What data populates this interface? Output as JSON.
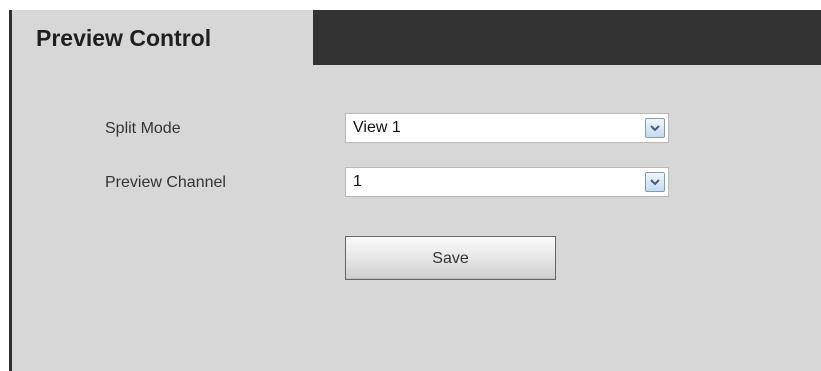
{
  "header": {
    "title": "Preview Control"
  },
  "form": {
    "split_mode": {
      "label": "Split Mode",
      "value": "View 1"
    },
    "preview_channel": {
      "label": "Preview Channel",
      "value": "1"
    },
    "save_label": "Save"
  },
  "icons": {
    "dropdown": "chevron-down-icon"
  },
  "colors": {
    "panel_background": "#d7d7d7",
    "header_bar": "#333333",
    "dropdown_border": "#7f9db9"
  }
}
